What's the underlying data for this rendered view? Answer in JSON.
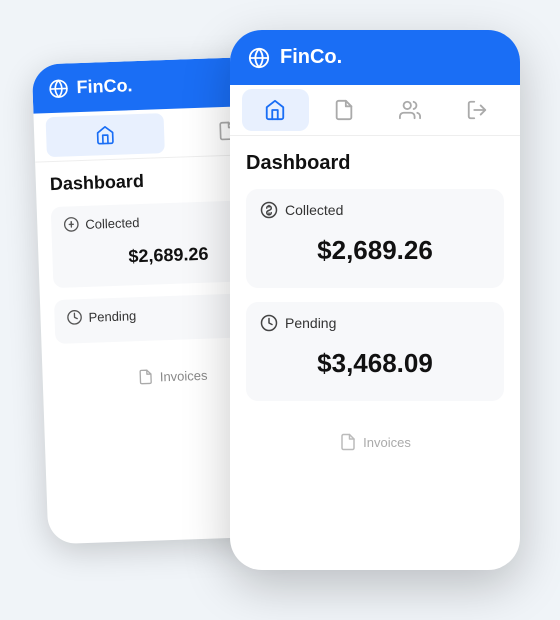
{
  "app": {
    "brand": "FinCo.",
    "page_title": "Dashboard"
  },
  "nav": {
    "items": [
      {
        "id": "home",
        "label": "Home",
        "active": true
      },
      {
        "id": "documents",
        "label": "Documents",
        "active": false
      },
      {
        "id": "users",
        "label": "Users",
        "active": false
      },
      {
        "id": "logout",
        "label": "Logout",
        "active": false
      }
    ]
  },
  "cards": [
    {
      "id": "collected",
      "label": "Collected",
      "value": "$2,689.26",
      "icon": "dollar-circle"
    },
    {
      "id": "pending",
      "label": "Pending",
      "value": "$3,468.09",
      "icon": "clock"
    }
  ],
  "bottom_nav": {
    "label": "Invoices"
  },
  "colors": {
    "brand_blue": "#1a6ef5",
    "nav_active_bg": "#e8f0fe",
    "card_bg": "#f7f8fa",
    "text_dark": "#111111",
    "text_muted": "#888888"
  }
}
